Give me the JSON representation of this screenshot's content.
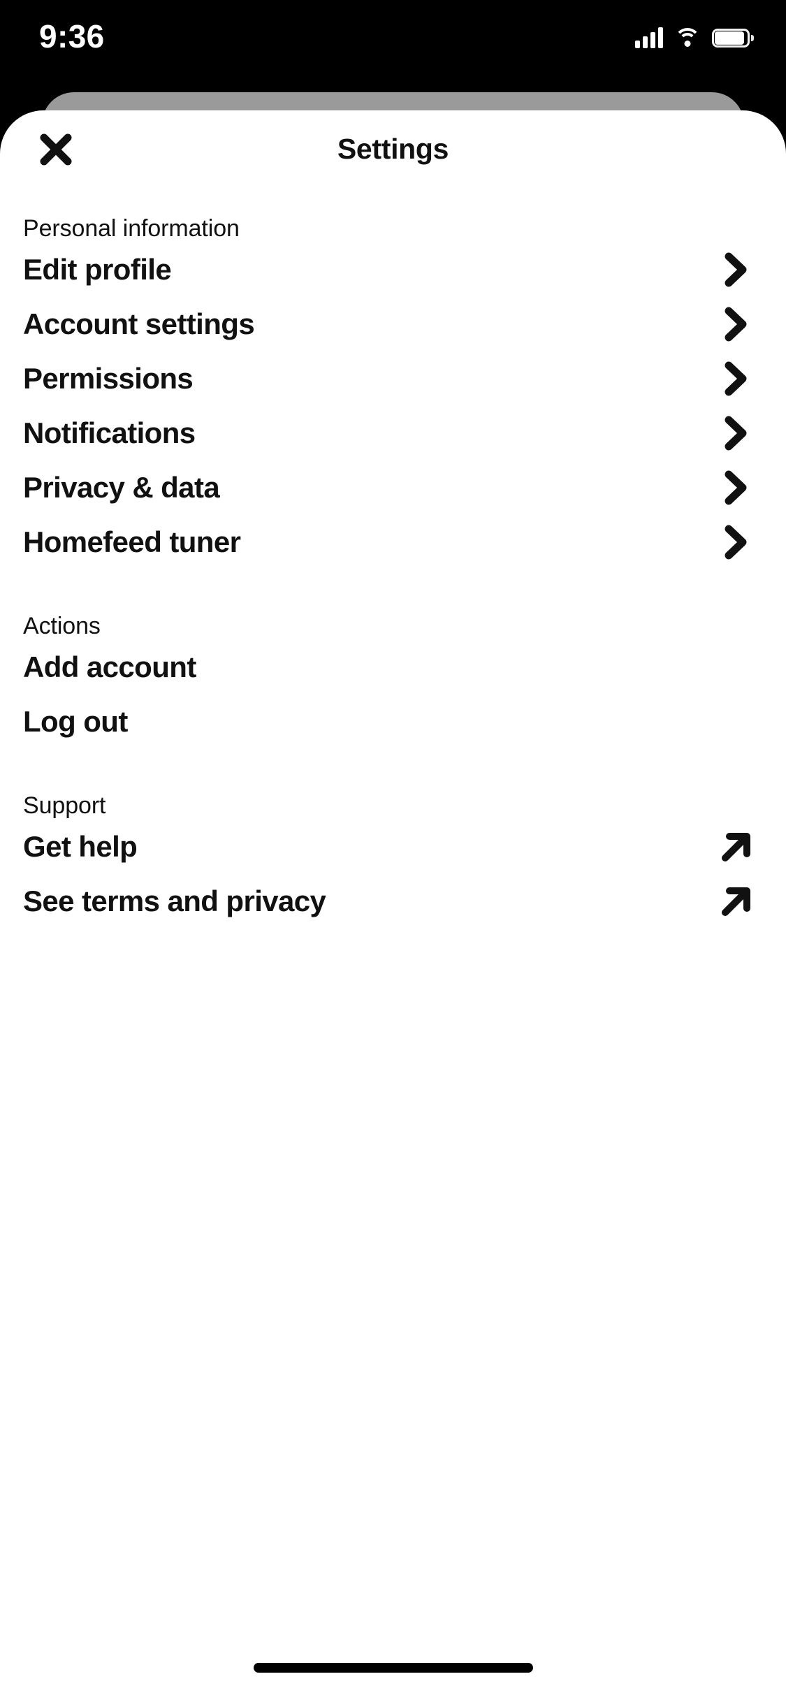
{
  "status_bar": {
    "time": "9:36",
    "signal_icon": "cellular-signal-icon",
    "wifi_icon": "wifi-icon",
    "battery_icon": "battery-icon"
  },
  "header": {
    "title": "Settings",
    "close_icon": "close-x-icon"
  },
  "colors": {
    "background": "#000000",
    "sheet": "#ffffff",
    "backing_card": "#9a9a9a",
    "text": "#111111"
  },
  "sections": [
    {
      "header": "Personal information",
      "items": [
        {
          "label": "Edit profile",
          "affordance": "chevron-right-icon"
        },
        {
          "label": "Account settings",
          "affordance": "chevron-right-icon"
        },
        {
          "label": "Permissions",
          "affordance": "chevron-right-icon"
        },
        {
          "label": "Notifications",
          "affordance": "chevron-right-icon"
        },
        {
          "label": "Privacy & data",
          "affordance": "chevron-right-icon"
        },
        {
          "label": "Homefeed tuner",
          "affordance": "chevron-right-icon"
        }
      ]
    },
    {
      "header": "Actions",
      "items": [
        {
          "label": "Add account",
          "affordance": "none"
        },
        {
          "label": "Log out",
          "affordance": "none"
        }
      ]
    },
    {
      "header": "Support",
      "items": [
        {
          "label": "Get help",
          "affordance": "external-link-arrow-icon"
        },
        {
          "label": "See terms and privacy",
          "affordance": "external-link-arrow-icon"
        }
      ]
    }
  ],
  "home_indicator": "home-indicator-bar"
}
